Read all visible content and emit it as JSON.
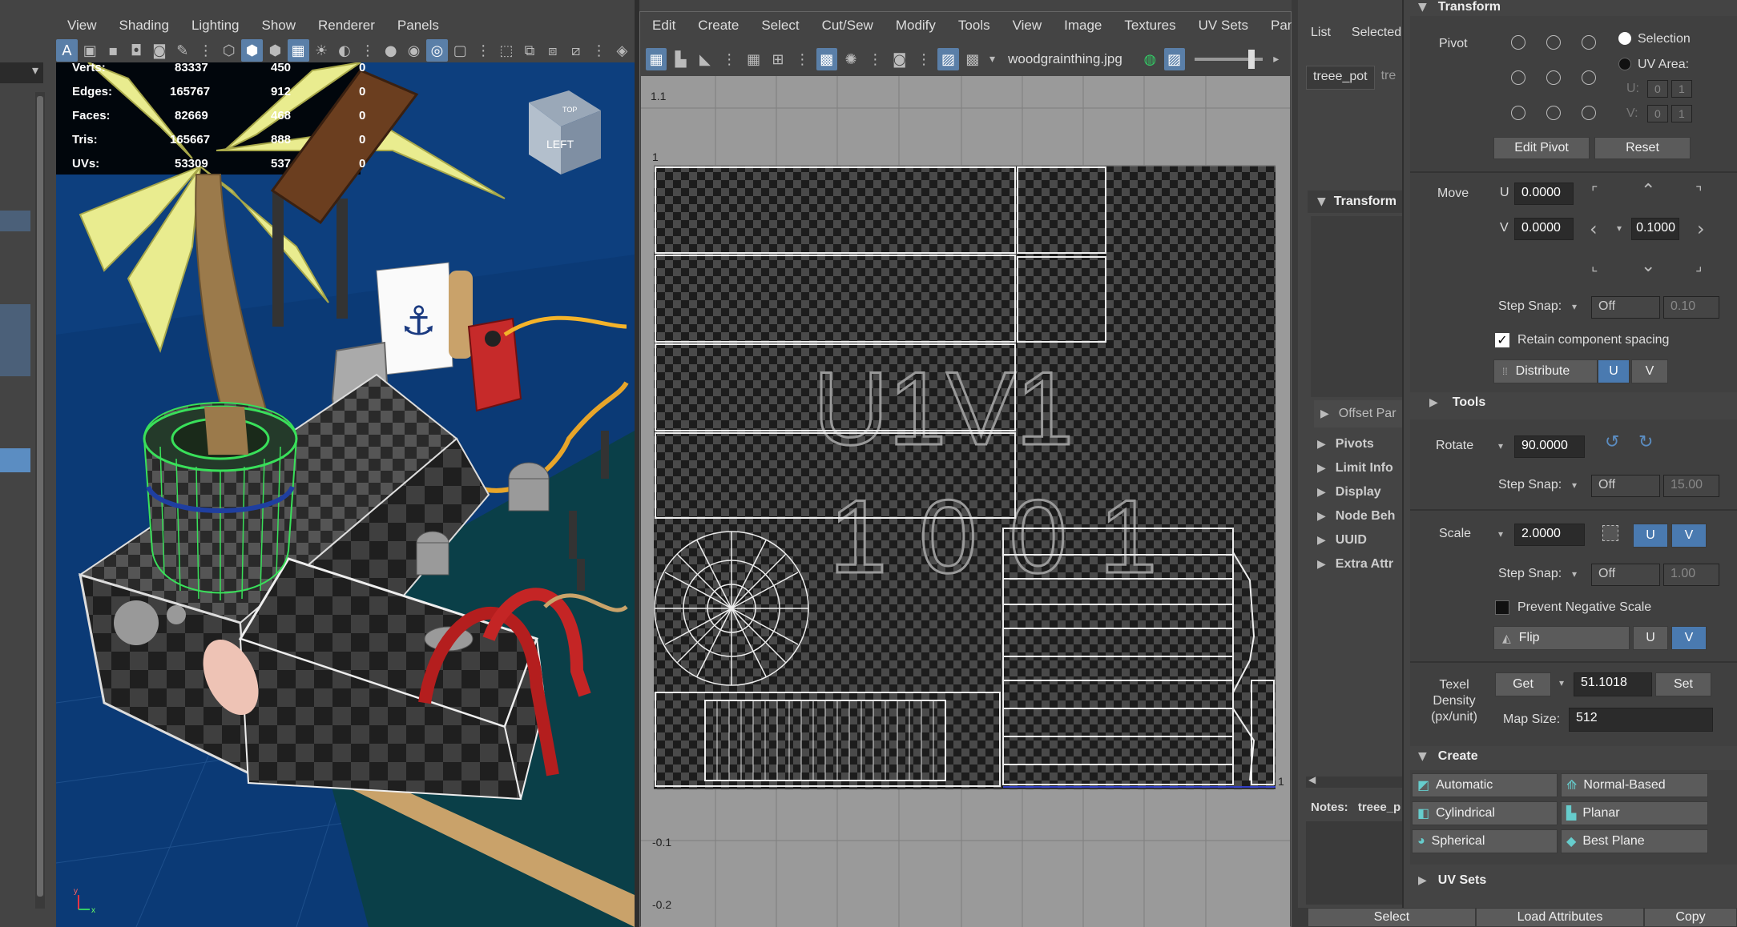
{
  "viewport": {
    "menu": [
      "View",
      "Shading",
      "Lighting",
      "Show",
      "Renderer",
      "Panels"
    ],
    "hud": [
      {
        "label": "Verts:",
        "a": "83337",
        "b": "450",
        "c": "0"
      },
      {
        "label": "Edges:",
        "a": "165767",
        "b": "912",
        "c": "0"
      },
      {
        "label": "Faces:",
        "a": "82669",
        "b": "468",
        "c": "0"
      },
      {
        "label": "Tris:",
        "a": "165667",
        "b": "888",
        "c": "0"
      },
      {
        "label": "UVs:",
        "a": "53309",
        "b": "537",
        "c": "0"
      }
    ],
    "viewcube_label": "LEFT",
    "viewcube_top": "TOP"
  },
  "uv_editor": {
    "menu": [
      "Edit",
      "Create",
      "Select",
      "Cut/Sew",
      "Modify",
      "Tools",
      "View",
      "Image",
      "Textures",
      "UV Sets",
      "Panels"
    ],
    "texture_name": "woodgrainthing.jpg",
    "tile_label_1": "U1V1",
    "tile_label_2": "1001",
    "axis_labels": {
      "v_1_1": "1.1",
      "v_1": "1",
      "v_m01": "-0.1",
      "v_m02": "-0.2",
      "u_1": "1"
    }
  },
  "outliner": {
    "tabs": [
      "List",
      "Selected"
    ],
    "node_tabs": [
      "treee_pot",
      "tre"
    ],
    "sections": [
      "Transform",
      "Offset Par",
      "Pivots",
      "Limit Info",
      "Display",
      "Node Beh",
      "UUID",
      "Extra Attr"
    ],
    "notes_label": "Notes:",
    "notes_value": "treee_p",
    "bottom_buttons": [
      "Select",
      "Load Attributes",
      "Copy"
    ]
  },
  "uv_toolkit": {
    "transform_header": "Transform",
    "pivot_label": "Pivot",
    "selection_label": "Selection",
    "uv_area_label": "UV Area:",
    "u_label": "U:",
    "v_label": "V:",
    "u_vals": [
      "0",
      "1"
    ],
    "v_vals": [
      "0",
      "1"
    ],
    "edit_pivot": "Edit Pivot",
    "reset": "Reset",
    "move_label": "Move",
    "move_u_label": "U",
    "move_v_label": "V",
    "move_u": "0.0000",
    "move_v": "0.0000",
    "move_step": "0.1000",
    "step_snap_label": "Step Snap:",
    "off": "Off",
    "move_snap_val": "0.10",
    "retain_label": "Retain component spacing",
    "distribute_label": "Distribute",
    "u_btn": "U",
    "v_btn": "V",
    "tools_header": "Tools",
    "rotate_label": "Rotate",
    "rotate_val": "90.0000",
    "rotate_snap_val": "15.00",
    "scale_label": "Scale",
    "scale_val": "2.0000",
    "scale_snap_val": "1.00",
    "prevent_neg_label": "Prevent Negative Scale",
    "flip_label": "Flip",
    "texel_label": "Texel Density (px/unit)",
    "get_label": "Get",
    "texel_val": "51.1018",
    "set_label": "Set",
    "map_size_label": "Map Size:",
    "map_size_val": "512",
    "create_header": "Create",
    "create_items": [
      "Automatic",
      "Normal-Based",
      "Cylindrical",
      "Planar",
      "Spherical",
      "Best Plane"
    ],
    "uvsets_header": "UV Sets"
  },
  "colors": {
    "viewport_bg": "#0d3f7e",
    "uv_bg": "#9a9a9a",
    "panel_bg": "#444444",
    "accent": "#4a7ab0",
    "wire_green": "#39e05a"
  }
}
